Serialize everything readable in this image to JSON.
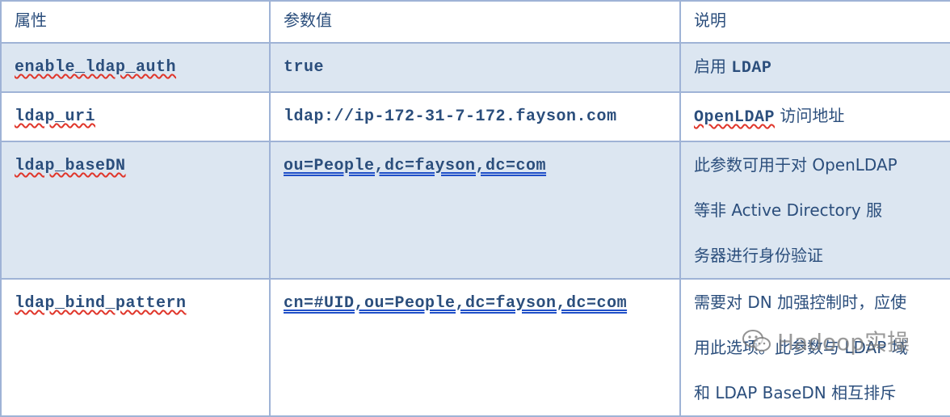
{
  "header": {
    "col1": "属性",
    "col2": "参数值",
    "col3": "说明"
  },
  "rows": [
    {
      "property": "enable_ldap_auth",
      "value": "true",
      "desc_parts": [
        "启用 ",
        "LDAP"
      ]
    },
    {
      "property": "ldap_uri",
      "value": "ldap://ip-172-31-7-172.fayson.com",
      "desc_parts": [
        "OpenLDAP",
        " 访问地址"
      ]
    },
    {
      "property": "ldap_baseDN",
      "value": "ou=People,dc=fayson,dc=com",
      "desc_lines": [
        "此参数可用于对 OpenLDAP",
        "等非 Active Directory 服",
        "务器进行身份验证"
      ]
    },
    {
      "property": "ldap_bind_pattern",
      "value": "cn=#UID,ou=People,dc=fayson,dc=com",
      "desc_lines": [
        "需要对 DN 加强控制时，应使",
        "用此选项。此参数与 LDAP 域",
        "和 LDAP BaseDN 相互排斥"
      ]
    }
  ],
  "watermark": {
    "text": "Hadoop实操",
    "icon": "wechat-icon"
  },
  "colors": {
    "border": "#9fb3d6",
    "shade": "#dce6f1",
    "text": "#2b4e7c",
    "squiggle": "#e0362b"
  }
}
